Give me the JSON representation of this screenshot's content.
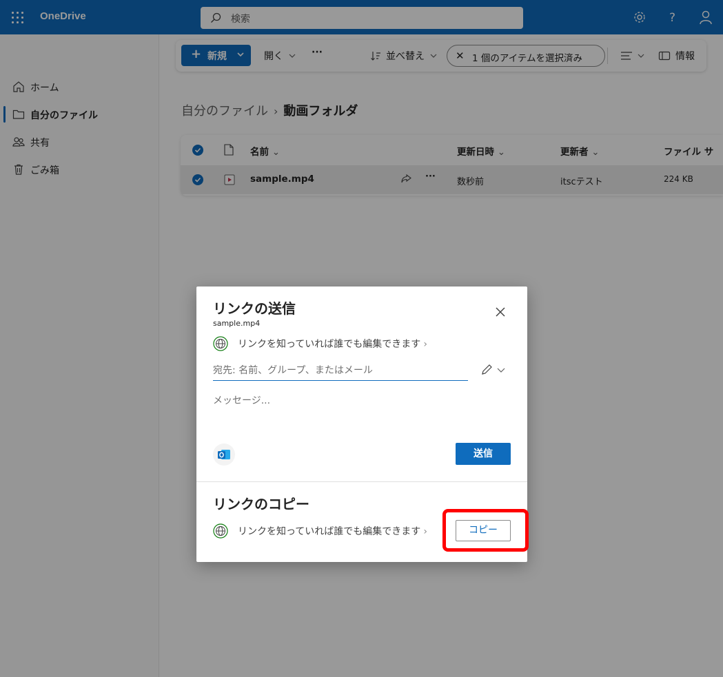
{
  "topbar": {
    "app_name": "OneDrive",
    "search_placeholder": "検索",
    "accent_color": "#0f6cbd"
  },
  "leftnav": {
    "items": [
      {
        "label": "ホーム",
        "icon": "home-icon"
      },
      {
        "label": "自分のファイル",
        "icon": "folder-icon",
        "active": true
      },
      {
        "label": "共有",
        "icon": "people-icon"
      },
      {
        "label": "ごみ箱",
        "icon": "trash-icon"
      }
    ]
  },
  "toolbar": {
    "new_label": "新規",
    "open_label": "開く",
    "more_label": "···",
    "sort_label": "並べ替え",
    "selection_label": "1 個のアイテムを選択済み",
    "info_label": "情報"
  },
  "breadcrumb": {
    "parent": "自分のファイル",
    "separator": "›",
    "current": "動画フォルダ"
  },
  "file_list": {
    "columns": [
      "名前",
      "更新日時",
      "更新者",
      "ファイル サ"
    ],
    "rows": [
      {
        "name": "sample.mp4",
        "modified": "数秒前",
        "modified_by": "itscテスト",
        "size": "224 KB"
      }
    ]
  },
  "dialog": {
    "title": "リンクの送信",
    "file_name": "sample.mp4",
    "permission_text": "リンクを知っていれば誰でも編集できます",
    "to_placeholder": "宛先: 名前、グループ、またはメール",
    "message_placeholder": "メッセージ...",
    "send_label": "送信",
    "copy_section_title": "リンクのコピー",
    "copy_permission_text": "リンクを知っていれば誰でも編集できます",
    "copy_label": "コピー"
  }
}
